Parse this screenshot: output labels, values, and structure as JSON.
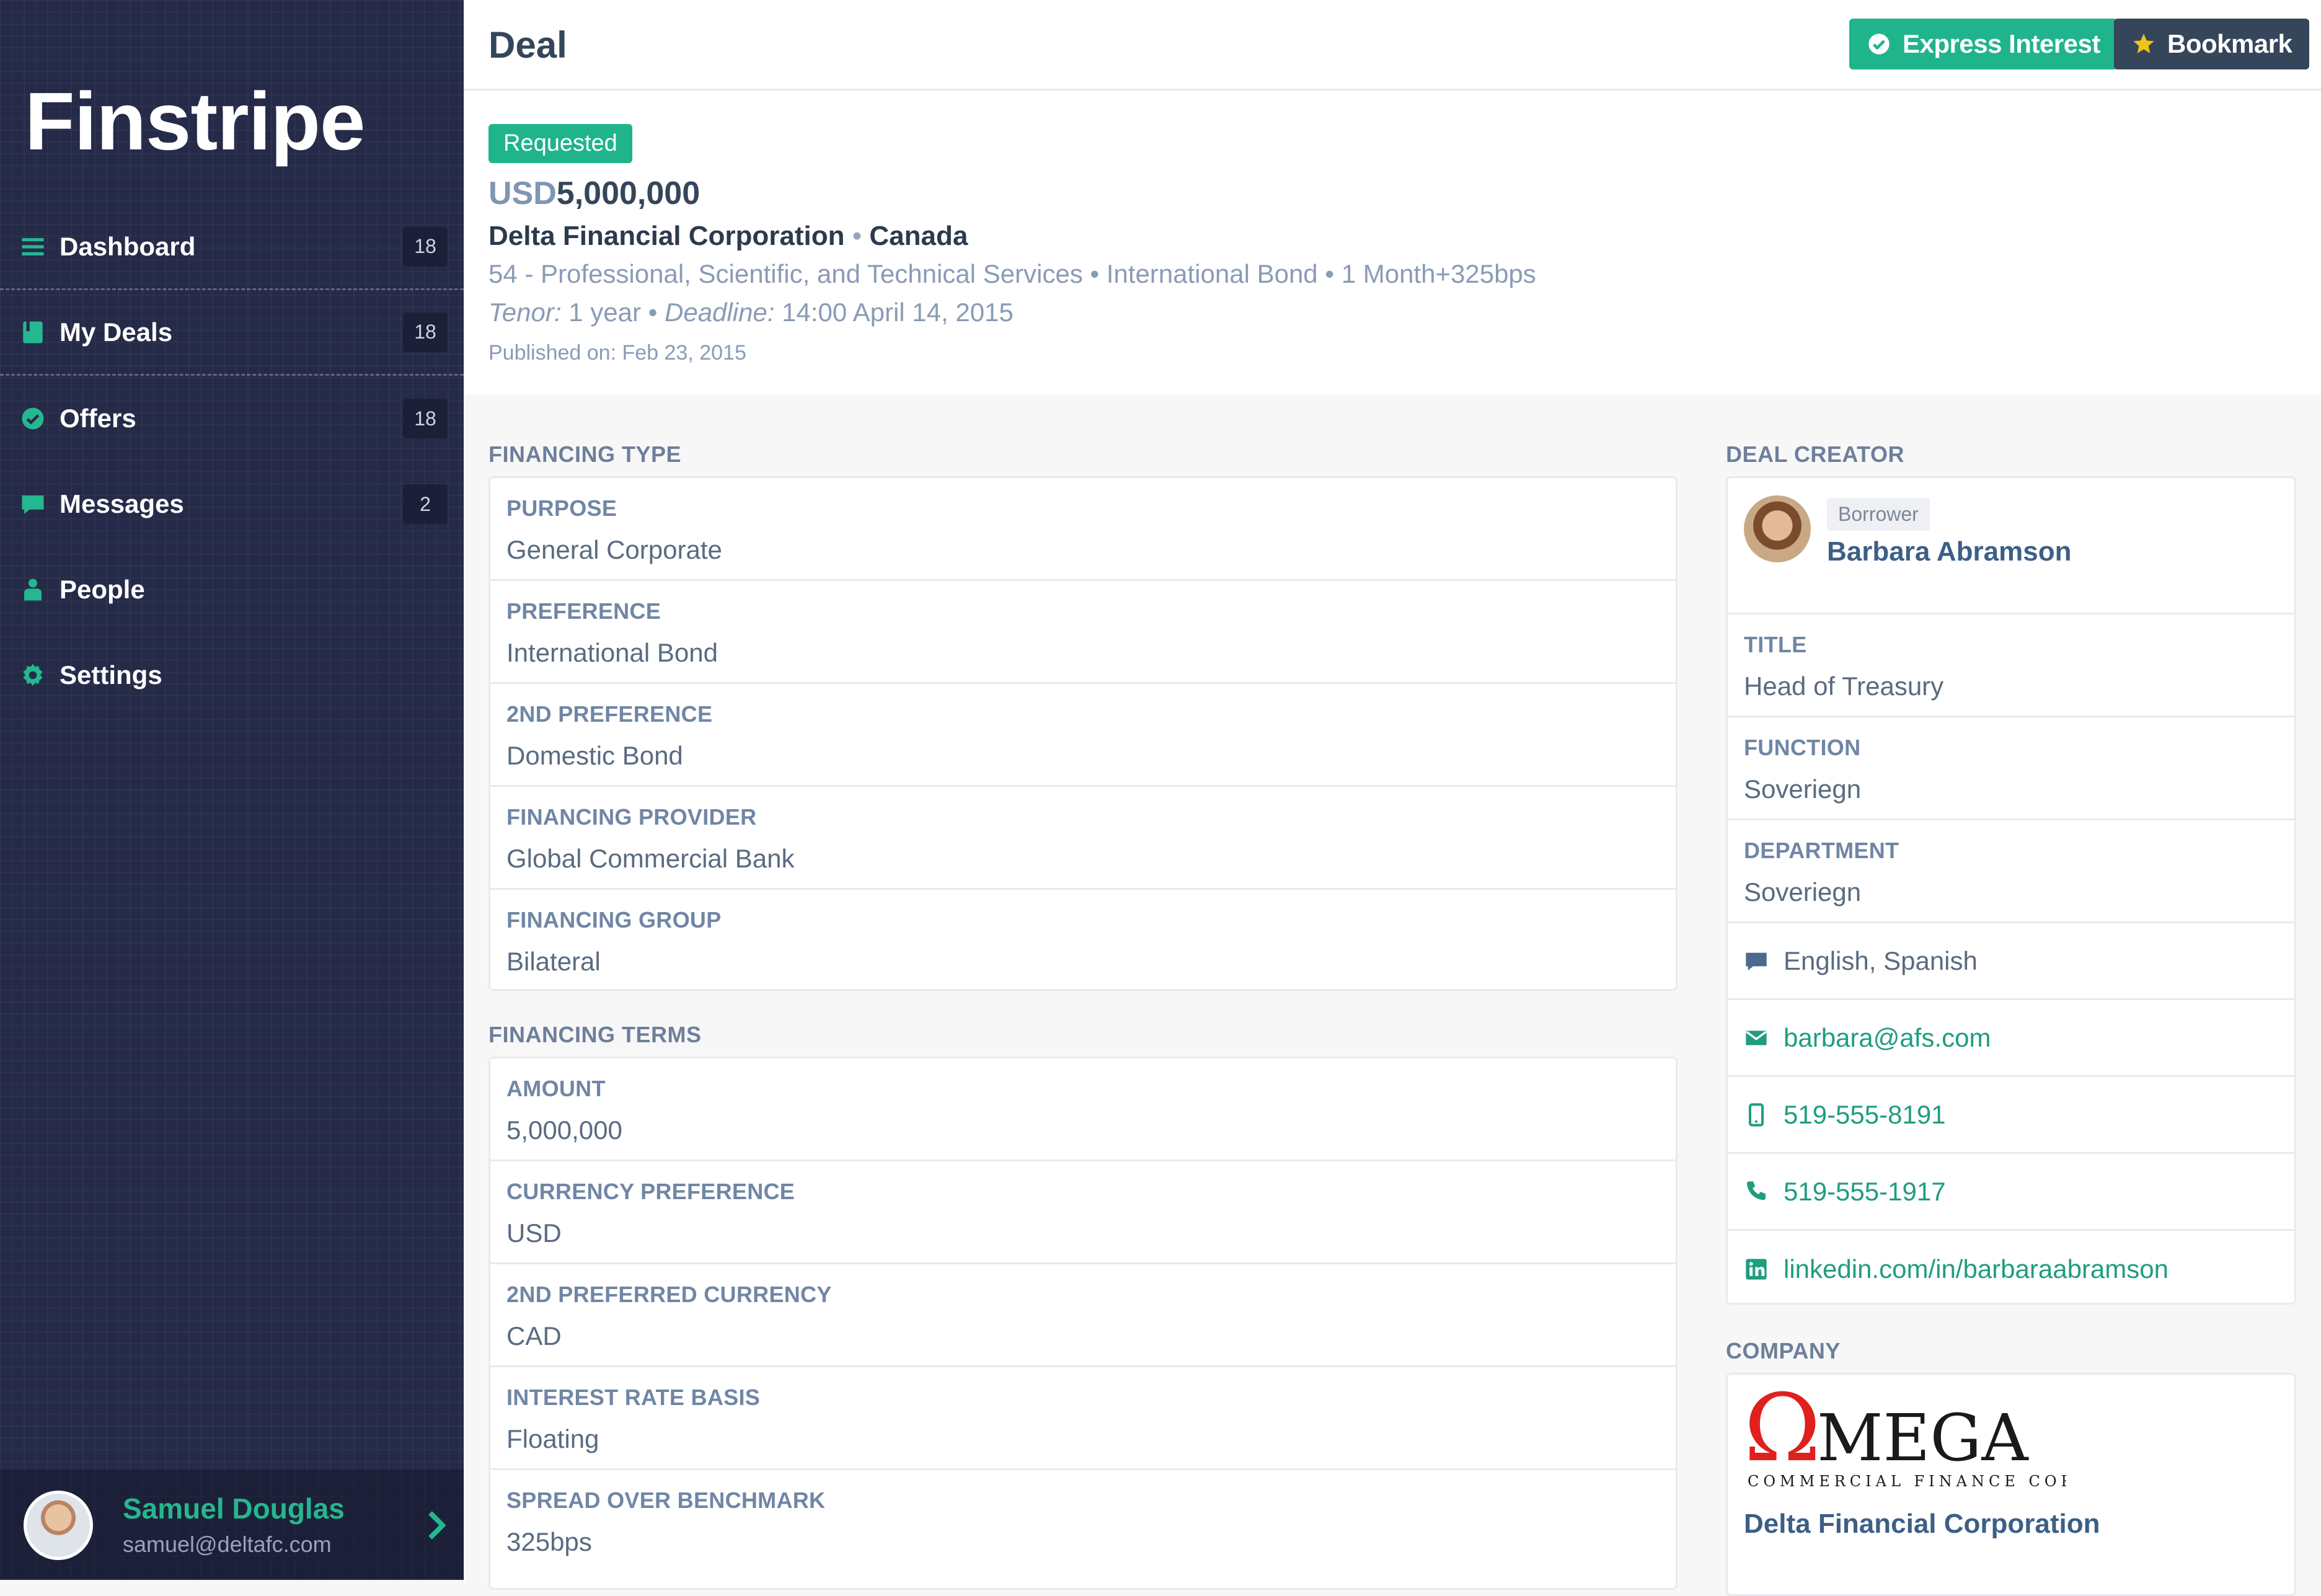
{
  "app": {
    "brand": "Finstripe"
  },
  "sidebar": {
    "items": [
      {
        "label": "Dashboard",
        "badge": "18",
        "icon": "list-icon"
      },
      {
        "label": "My Deals",
        "badge": "18",
        "icon": "book-icon"
      },
      {
        "label": "Offers",
        "badge": "18",
        "icon": "check-circle-icon"
      },
      {
        "label": "Messages",
        "badge": "2",
        "icon": "chat-icon"
      },
      {
        "label": "People",
        "badge": "",
        "icon": "person-icon"
      },
      {
        "label": "Settings",
        "badge": "",
        "icon": "gear-icon"
      }
    ],
    "user": {
      "name": "Samuel Douglas",
      "email": "samuel@deltafc.com"
    }
  },
  "header": {
    "title": "Deal",
    "express_label": "Express Interest",
    "bookmark_label": "Bookmark"
  },
  "summary": {
    "status": "Requested",
    "currency": "USD",
    "amount": "5,000,000",
    "company": "Delta Financial Corporation",
    "separator": "•",
    "country": "Canada",
    "meta": "54 - Professional, Scientific, and Technical Services • International Bond • 1 Month+325bps",
    "tenor_label": "Tenor:",
    "tenor_value": "1 year",
    "deadline_label": "Deadline:",
    "deadline_value": "14:00 April 14, 2015",
    "bullet": "•",
    "published": "Published on: Feb 23, 2015"
  },
  "financing_type": {
    "title": "FINANCING TYPE",
    "fields": [
      {
        "label": "PURPOSE",
        "value": "General Corporate"
      },
      {
        "label": "PREFERENCE",
        "value": "International Bond"
      },
      {
        "label": "2ND PREFERENCE",
        "value": "Domestic Bond"
      },
      {
        "label": "FINANCING PROVIDER",
        "value": "Global Commercial Bank"
      },
      {
        "label": "FINANCING GROUP",
        "value": "Bilateral"
      }
    ]
  },
  "financing_terms": {
    "title": "FINANCING TERMS",
    "fields": [
      {
        "label": "AMOUNT",
        "value": "5,000,000"
      },
      {
        "label": "CURRENCY PREFERENCE",
        "value": "USD"
      },
      {
        "label": "2ND PREFERRED CURRENCY",
        "value": "CAD"
      },
      {
        "label": "INTEREST RATE BASIS",
        "value": "Floating"
      },
      {
        "label": "SPREAD OVER BENCHMARK",
        "value": "325bps"
      }
    ]
  },
  "creator": {
    "title": "DEAL CREATOR",
    "role": "Borrower",
    "name": "Barbara Abramson",
    "fields": [
      {
        "label": "TITLE",
        "value": "Head of Treasury"
      },
      {
        "label": "FUNCTION",
        "value": "Soveriegn"
      },
      {
        "label": "DEPARTMENT",
        "value": "Soveriegn"
      }
    ],
    "languages": "English, Spanish",
    "email": "barbara@afs.com",
    "mobile": "519-555-8191",
    "phone": "519-555-1917",
    "linkedin": "linkedin.com/in/barbaraabramson"
  },
  "company": {
    "title": "COMPANY",
    "logo_mark": "Ω",
    "logo_word": "MEGA",
    "logo_tagline": "COMMERCIAL FINANCE CORP",
    "name": "Delta Financial Corporation"
  },
  "colors": {
    "accent": "#1fb48c",
    "sidebar": "#252a48",
    "dark_button": "#35455a"
  }
}
